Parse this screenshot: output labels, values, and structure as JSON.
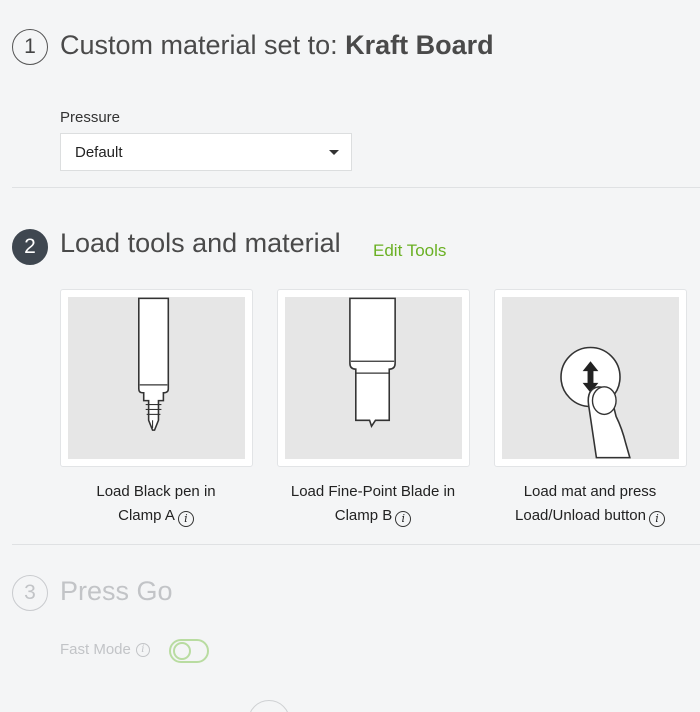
{
  "step1": {
    "number": "1",
    "title_prefix": "Custom material set to: ",
    "title_material": "Kraft Board",
    "pressure_label": "Pressure",
    "pressure_value": "Default"
  },
  "step2": {
    "number": "2",
    "title": "Load tools and material",
    "edit_tools_label": "Edit Tools",
    "cards": [
      {
        "caption_line1": "Load Black pen in",
        "caption_line2": "Clamp A"
      },
      {
        "caption_line1": "Load Fine-Point Blade in",
        "caption_line2": "Clamp B"
      },
      {
        "caption_line1": "Load mat and press",
        "caption_line2": "Load/Unload button"
      }
    ],
    "info_glyph": "i"
  },
  "step3": {
    "number": "3",
    "title": "Press Go",
    "fast_mode_label": "Fast Mode",
    "fast_mode_on": false
  },
  "colors": {
    "accent_green": "#6ab023",
    "step_filled": "#3f4750",
    "disabled_text": "#c2c4c7"
  }
}
